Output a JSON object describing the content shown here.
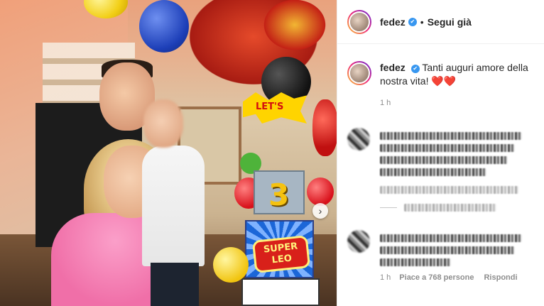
{
  "post": {
    "username": "fedez",
    "follow_status": "Segui già",
    "dot": "•",
    "verified_glyph": "✔",
    "carousel_next_glyph": "›",
    "image": {
      "cake_number": "3",
      "cake_sign": "SUPER LEO",
      "comic_text": "LET'S"
    }
  },
  "caption": {
    "username": "fedez",
    "text": "Tanti auguri amore della nostra vita! ❤️❤️",
    "time": "1 h"
  },
  "comments": [
    {
      "blurred": true,
      "time": "",
      "likes": "",
      "reply": ""
    },
    {
      "blurred": true,
      "time": "1 h",
      "likes": "Piace a 768 persone",
      "reply": "Rispondi"
    }
  ],
  "colors": {
    "verified": "#3897f0",
    "meta_text": "#8e8e8e",
    "text": "#262626"
  }
}
